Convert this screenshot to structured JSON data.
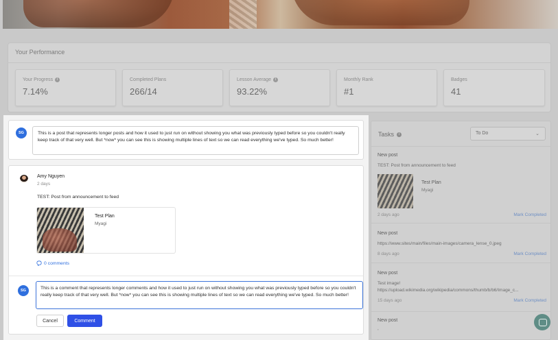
{
  "performance": {
    "title": "Your Performance",
    "stats": [
      {
        "label": "Your Progress",
        "value": "7.14%",
        "info": true
      },
      {
        "label": "Completed Plans",
        "value": "266/14",
        "info": false
      },
      {
        "label": "Lesson Average",
        "value": "93.22%",
        "info": true
      },
      {
        "label": "Monthly Rank",
        "value": "#1",
        "info": false
      },
      {
        "label": "Badges",
        "value": "41",
        "info": false
      }
    ]
  },
  "composer": {
    "avatar_initials": "SG",
    "text": "This is a post that represents longer posts and how it used to just run on without showing you what was previously typed before so you couldn't really keep track of that very well. But *now* you can see this is showing multiple lines of text so we can read everything we've typed. So much better!"
  },
  "feed_post": {
    "author": "Amy Nguyen",
    "time": "2 days",
    "text": "TEST: Post from announcement to feed",
    "attachment_title": "Test Plan",
    "attachment_subtitle": "Myagi",
    "comments_label": "0 comments",
    "comment_avatar_initials": "SG",
    "comment_text": "This is a comment that represents longer comments and how it used to just run on without showing you what was previously typed before so you couldn't really keep track of that very well. But *now* you can see this is showing multiple lines of text so we can read everything we've typed. So much better!",
    "cancel_label": "Cancel",
    "comment_label": "Comment"
  },
  "tasks": {
    "title": "Tasks",
    "filter_value": "To Do",
    "items": [
      {
        "title": "New post",
        "body": "TEST: Post from announcement to feed",
        "attach_title": "Test Plan",
        "attach_sub": "Myagi",
        "time": "2 days ago",
        "action": "Mark Completed"
      },
      {
        "title": "New post",
        "body": "https://www.sites/main/files/main-images/camera_lense_0.jpeg",
        "time": "8 days ago",
        "action": "Mark Completed"
      },
      {
        "title": "New post",
        "body": "Test image!",
        "body2": "https://upload.wikimedia.org/wikipedia/commons/thumb/b/b6/Image_c...",
        "time": "15 days ago",
        "action": "Mark Completed"
      },
      {
        "title": "New post",
        "body": ","
      }
    ]
  },
  "colors": {
    "accent": "#2f50e6",
    "link": "#2f6fde",
    "avatar": "#2f6fde",
    "chat": "#5f8d86"
  }
}
